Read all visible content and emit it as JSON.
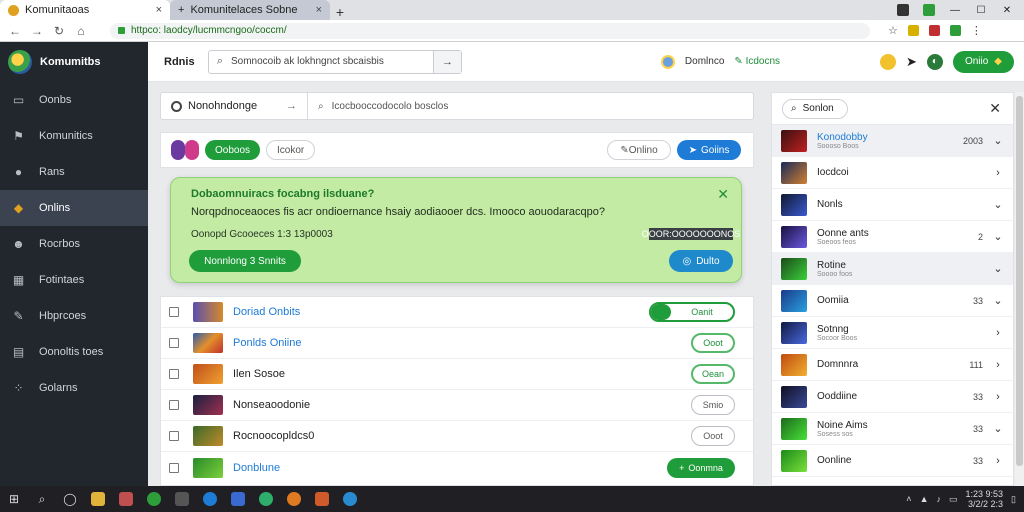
{
  "browser": {
    "tabs": [
      {
        "title": "Komunitaoas",
        "active": true
      },
      {
        "title": "Komunitelaces Sobne",
        "active": false
      }
    ],
    "url": "httpco: laodcy/lucmmcngoo/coccm/",
    "new_tab": "+",
    "close": "×"
  },
  "app": {
    "brand": "Komumitbs",
    "header_title": "Rdnis",
    "search_placeholder": "Somnocoib ak lokhngnct sbcaisbis",
    "search_go": "→",
    "user": {
      "name": "Domlnco",
      "link": "Icdocns",
      "cta": "Oniio"
    }
  },
  "sidebar": {
    "items": [
      {
        "label": "Oonbs",
        "icon": "monitor-icon"
      },
      {
        "label": "Komunitics",
        "icon": "flag-icon"
      },
      {
        "label": "Rans",
        "icon": "globe-icon"
      },
      {
        "label": "Onlins",
        "icon": "avatar-icon",
        "active": true
      },
      {
        "label": "Rocrbos",
        "icon": "people-icon"
      },
      {
        "label": "Fotintaes",
        "icon": "grid-icon"
      },
      {
        "label": "Hbprcoes",
        "icon": "wrench-icon"
      },
      {
        "label": "Oonoltis toes",
        "icon": "monitor-icon"
      },
      {
        "label": "Golarns",
        "icon": "dots-icon"
      }
    ]
  },
  "main": {
    "section": "Nonohndonge",
    "section_arrow": "→",
    "search_text": "Icocbooccodocolo bosclos",
    "filter": {
      "primary": "Ooboos",
      "secondary": "Icokor",
      "online": "Onlino",
      "share": "Goiins"
    },
    "notice": {
      "heading": "Dobaomnuiracs focabng ilsduane?",
      "question": "Norqpdnoceaoces fis acr ondioernance hsaiy aodiaooer dcs. Imooco aouodaracqpo?",
      "meta": "Oonopd  Gcooeces 1:3 13p0003",
      "code": "OOOR:OOOOOOONOS",
      "primary_action": "Nonnlong  3  Snnits",
      "secondary_action": "Dulto"
    },
    "rows": [
      {
        "name": "Doriad Onbits",
        "style": "blue",
        "button": "Oanit",
        "btn_type": "toggle"
      },
      {
        "name": "Ponlds Oniine",
        "style": "blue",
        "button": "Ooot",
        "btn_type": "ol"
      },
      {
        "name": "Ilen Sosoe",
        "style": "",
        "button": "Oean",
        "btn_type": "ol"
      },
      {
        "name": "Nonseaoodonie",
        "style": "",
        "button": "Smio",
        "btn_type": "ol"
      },
      {
        "name": "Rocnoocopldcs0",
        "style": "",
        "button": "Ooot",
        "btn_type": "olg"
      },
      {
        "name": "Donblune",
        "style": "blue",
        "button": "Oonmna",
        "btn_type": "solid"
      }
    ]
  },
  "right_panel": {
    "search": "Sonlon",
    "items": [
      {
        "title": "Konodobby",
        "sub": "Soooso Boos",
        "value": "2003",
        "chev": "⌄",
        "blue": true,
        "hl": true
      },
      {
        "title": "Iocdcoi",
        "sub": "",
        "value": "",
        "chev": "›"
      },
      {
        "title": "Nonls",
        "sub": "",
        "value": "",
        "chev": "⌄"
      },
      {
        "title": "Oonne ants",
        "sub": "Soeoos feos",
        "value": "2",
        "chev": "⌄"
      },
      {
        "title": "Rotine",
        "sub": "Soooo foos",
        "value": "",
        "chev": "⌄",
        "hl": true
      },
      {
        "title": "Oomiia",
        "sub": "",
        "value": "33",
        "chev": "⌄"
      },
      {
        "title": "Sotnng",
        "sub": "Socoor Boos",
        "value": "",
        "chev": "›"
      },
      {
        "title": "Domnnra",
        "sub": "",
        "value": "111",
        "chev": "›"
      },
      {
        "title": "Ooddiine",
        "sub": "",
        "value": "33",
        "chev": "›"
      },
      {
        "title": "Noine Aims",
        "sub": "Sosess sos",
        "value": "33",
        "chev": "⌄"
      },
      {
        "title": "Oonline",
        "sub": "",
        "value": "33",
        "chev": "›"
      }
    ]
  },
  "taskbar": {
    "time": "1:23 9:53",
    "date": "3/2/2 2:3"
  },
  "colors": {
    "accent_green": "#1f9d3a",
    "accent_blue": "#1e7bd6",
    "sidebar_bg": "#22272e",
    "notice_bg": "#c4eba4"
  }
}
